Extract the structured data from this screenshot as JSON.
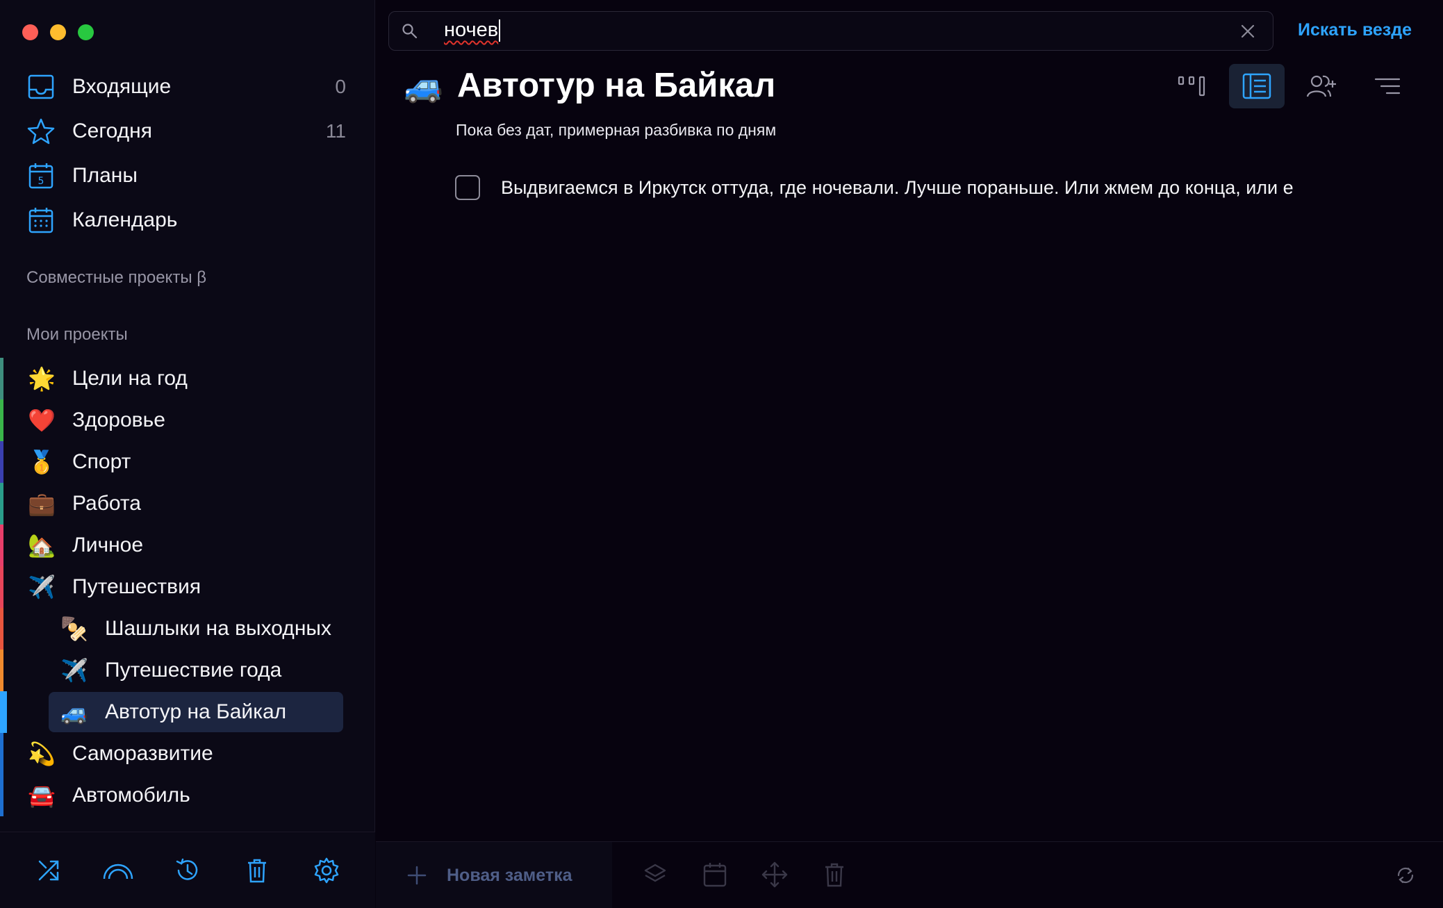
{
  "window": {
    "controls": [
      "close",
      "minimize",
      "zoom"
    ]
  },
  "sidebar": {
    "nav": [
      {
        "label": "Входящие",
        "count": "0",
        "icon": "inbox-icon"
      },
      {
        "label": "Сегодня",
        "count": "11",
        "icon": "star-icon"
      },
      {
        "label": "Планы",
        "count": "",
        "icon": "calendar-5-icon"
      },
      {
        "label": "Календарь",
        "count": "",
        "icon": "calendar-grid-icon"
      }
    ],
    "shared_projects_title": "Совместные проекты β",
    "my_projects_title": "Мои проекты",
    "projects": [
      {
        "emoji": "🌟",
        "label": "Цели на год",
        "color": "#3e8e7e"
      },
      {
        "emoji": "❤️",
        "label": "Здоровье",
        "color": "#3ab54a"
      },
      {
        "emoji": "🥇",
        "label": "Спорт",
        "color": "#3a3fb0"
      },
      {
        "emoji": "💼",
        "label": "Работа",
        "color": "#2a9d8a"
      },
      {
        "emoji": "🏡",
        "label": "Личное",
        "color": "#e83e6a"
      },
      {
        "emoji": "✈️",
        "label": "Путешествия",
        "color": "#e8455a"
      },
      {
        "emoji": "🍢",
        "label": "Шашлыки на выходных",
        "color": "#e8553e",
        "sub": true
      },
      {
        "emoji": "✈️",
        "label": "Путешествие года",
        "color": "#f08a2e",
        "sub": true
      },
      {
        "emoji": "🚙",
        "label": "Автотур на Байкал",
        "color": "#2ea4ff",
        "sub": true,
        "active": true
      },
      {
        "emoji": "💫",
        "label": "Саморазвитие",
        "color": "#1e6fd0"
      },
      {
        "emoji": "🚘",
        "label": "Автомобиль",
        "color": "#1e6fd0"
      }
    ],
    "bottom_icons": [
      "shuffle-icon",
      "rainbow-icon",
      "history-icon",
      "trash-icon",
      "settings-icon"
    ]
  },
  "search": {
    "value": "ночев",
    "clear_icon": "close-icon",
    "search_everywhere": "Искать везде"
  },
  "project": {
    "emoji": "🚙",
    "title": "Автотур на Байкал",
    "subtitle": "Пока без дат, примерная разбивка по дням",
    "toolbar": [
      "kanban-icon",
      "list-icon",
      "add-user-icon",
      "sort-icon"
    ]
  },
  "tasks": [
    {
      "checked": false,
      "text": "Выдвигаемся в Иркутск оттуда, где ночевали. Лучше пораньше. Или жмем до конца, или е"
    }
  ],
  "footer": {
    "new_note_label": "Новая заметка",
    "icons": [
      "layers-icon",
      "calendar-icon",
      "move-icon",
      "trash-icon"
    ],
    "sync_icon": "sync-icon"
  },
  "colors": {
    "accent": "#2ea4ff",
    "background": "#07030f",
    "sidebar": "#0b0916",
    "active_item": "#1c2540"
  }
}
